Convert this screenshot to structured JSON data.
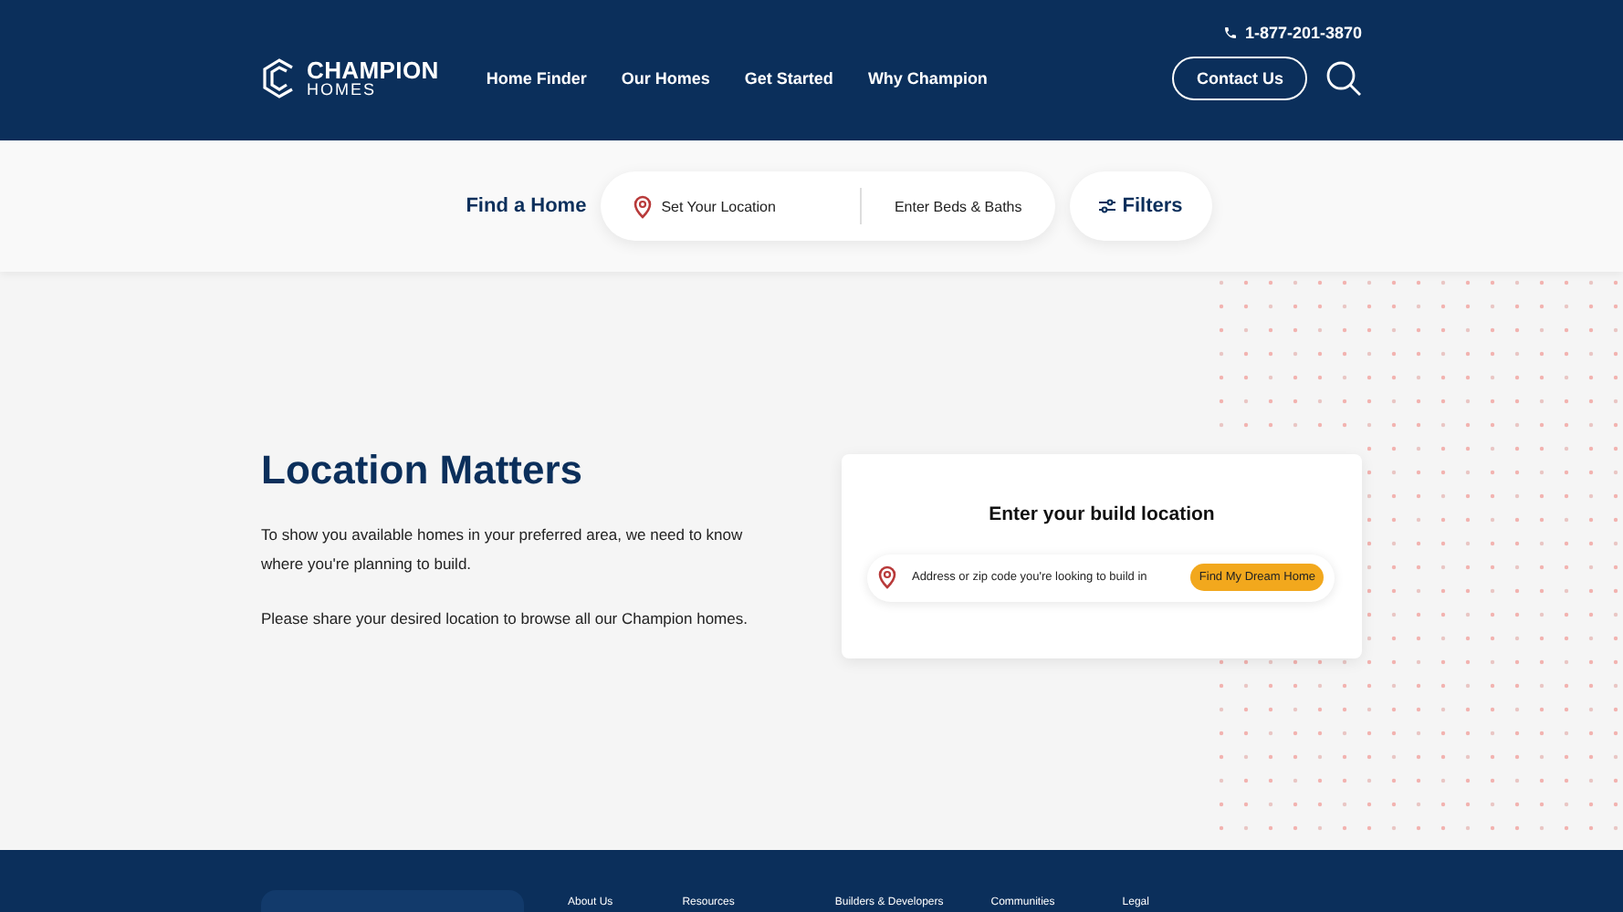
{
  "top_bar": {
    "phone": "1-877-201-3870"
  },
  "header": {
    "logo": {
      "name": "CHAMPION",
      "sub": "HOMES"
    },
    "nav": [
      "Home Finder",
      "Our Homes",
      "Get Started",
      "Why Champion"
    ],
    "contact_button": "Contact Us"
  },
  "finder": {
    "label": "Find a Home",
    "location": "Set Your Location",
    "beds_baths": "Enter Beds & Baths",
    "filters": "Filters"
  },
  "intro": {
    "title": "Location Matters",
    "paragraphs": [
      "To show you available homes in your preferred area, we need to know where you're planning to build.",
      "Please share your desired location to browse all our Champion homes."
    ]
  },
  "location_card": {
    "title": "Enter your build location",
    "placeholder": "Address or zip code you're looking to build in",
    "button": "Find My Dream Home"
  },
  "footer": {
    "links": [
      "About Us",
      "Resources",
      "Builders & Developers",
      "Communities",
      "Legal"
    ]
  }
}
